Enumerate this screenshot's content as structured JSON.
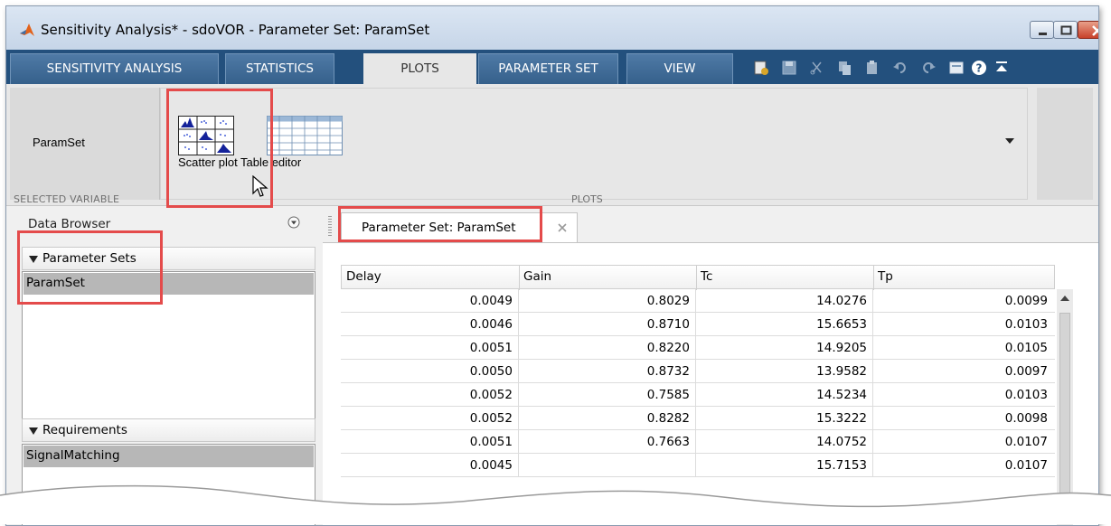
{
  "window": {
    "title": "Sensitivity Analysis* - sdoVOR - Parameter Set:  ParamSet"
  },
  "tabs": [
    {
      "label": "SENSITIVITY ANALYSIS"
    },
    {
      "label": "STATISTICS"
    },
    {
      "label": "PLOTS",
      "active": true
    },
    {
      "label": "PARAMETER SET"
    },
    {
      "label": "VIEW"
    }
  ],
  "ribbon": {
    "selected_variable": {
      "value": "ParamSet",
      "section_label": "SELECTED VARIABLE"
    },
    "plots": {
      "section_label": "PLOTS",
      "scatter_label": "Scatter plot",
      "table_label": "Table editor"
    }
  },
  "data_browser": {
    "title": "Data Browser",
    "parameter_sets": {
      "header": "Parameter Sets",
      "items": [
        "ParamSet"
      ]
    },
    "requirements": {
      "header": "Requirements",
      "items": [
        "SignalMatching"
      ]
    }
  },
  "document": {
    "tab_label": "Parameter Set:  ParamSet",
    "table": {
      "columns": [
        "Delay",
        "Gain",
        "Tc",
        "Tp"
      ],
      "rows": [
        [
          "0.0049",
          "0.8029",
          "14.0276",
          "0.0099"
        ],
        [
          "0.0046",
          "0.8710",
          "15.6653",
          "0.0103"
        ],
        [
          "0.0051",
          "0.8220",
          "14.9205",
          "0.0105"
        ],
        [
          "0.0050",
          "0.8732",
          "13.9582",
          "0.0097"
        ],
        [
          "0.0052",
          "0.7585",
          "14.5234",
          "0.0103"
        ],
        [
          "0.0052",
          "0.8282",
          "15.3222",
          "0.0098"
        ],
        [
          "0.0051",
          "0.7663",
          "14.0752",
          "0.0107"
        ],
        [
          "0.0045",
          "",
          "15.7153",
          "0.0107"
        ]
      ]
    }
  },
  "colors": {
    "tab_strip": "#23507d",
    "highlight": "#e44b4b",
    "selection": "#b7b7b7"
  },
  "icons": [
    "matlab-logo-icon",
    "minimize-icon",
    "maximize-icon",
    "close-icon",
    "new-icon",
    "save-icon",
    "cut-icon",
    "copy-icon",
    "paste-icon",
    "undo-icon",
    "redo-icon",
    "layout-icon",
    "help-icon",
    "collapse-ribbon-icon",
    "scatter-plot-icon",
    "table-editor-icon",
    "gallery-dropdown-icon",
    "browser-menu-icon",
    "close-tab-icon",
    "triangle-down-icon",
    "cursor-icon"
  ]
}
